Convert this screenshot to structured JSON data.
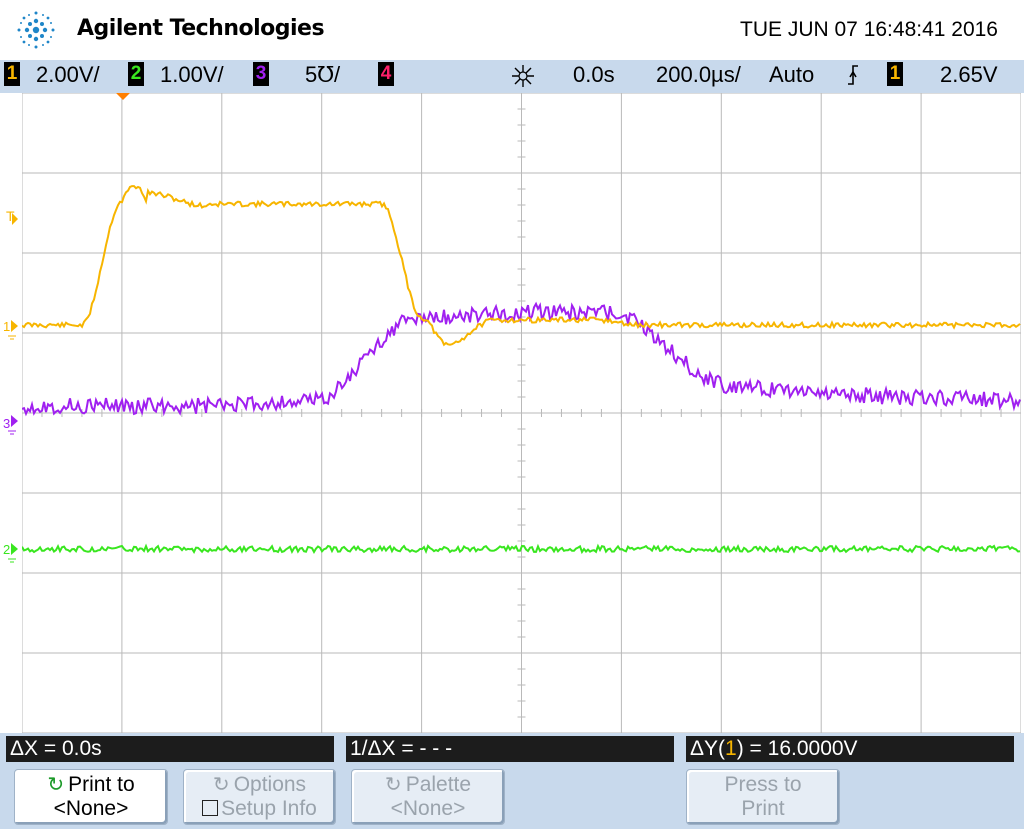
{
  "header": {
    "brand": "Agilent Technologies",
    "datetime": "TUE JUN 07 16:48:41 2016"
  },
  "status_bar": {
    "ch1_num": "1",
    "ch1_scale": "2.00V/",
    "ch2_num": "2",
    "ch2_scale": "1.00V/",
    "ch3_num": "3",
    "ch3_scale": "5℧/",
    "ch4_num": "4",
    "time_delay": "0.0s",
    "time_scale": "200.0µs/",
    "trigger_mode": "Auto",
    "trigger_source": "1",
    "trigger_level": "2.65V"
  },
  "markers": {
    "trigger": "T",
    "ch1": "1",
    "ch2": "2",
    "ch3": "3"
  },
  "measurements": {
    "dx": "ΔX = 0.0s",
    "inv_dx": "1/ΔX = - - -",
    "dy_prefix": "ΔY(",
    "dy_channel": "1",
    "dy_suffix": ") = 16.0000V"
  },
  "softkeys": [
    {
      "line1": "Print to",
      "line2": "<None>"
    },
    {
      "line1": "Options",
      "line2": "Setup Info"
    },
    {
      "line1": "Palette",
      "line2": "<None>"
    },
    {
      "line1": "Press to",
      "line2": "Print"
    }
  ],
  "colors": {
    "ch1": "#f7b500",
    "ch2": "#39e61f",
    "ch3": "#a020f0",
    "ch4": "#ff1f6a",
    "grid": "#b9b9b9",
    "status_bg": "#c8d9ec"
  }
}
